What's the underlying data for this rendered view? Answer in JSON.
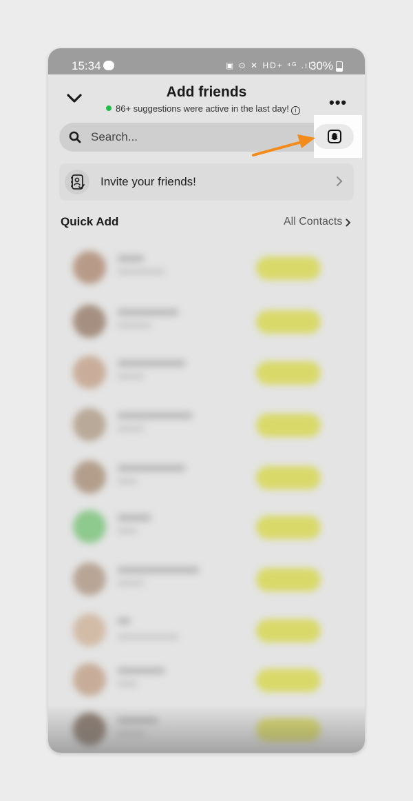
{
  "status_bar": {
    "time": "15:34",
    "icons_text": "▣ ⊙ ✕ HD+ ⁴ᴳ .ıl",
    "battery": "30%"
  },
  "header": {
    "title": "Add friends",
    "subtitle": "86+ suggestions were active in the last day!",
    "info_symbol": "i",
    "more_symbol": "•••"
  },
  "search": {
    "placeholder": "Search..."
  },
  "invite": {
    "label": "Invite your friends!"
  },
  "quick_add": {
    "title": "Quick Add",
    "all_contacts": "All Contacts"
  },
  "colors": {
    "accent_orange": "#f28a1c",
    "online_green": "#1fbf4a",
    "add_button_yellow": "#d9d96a"
  }
}
